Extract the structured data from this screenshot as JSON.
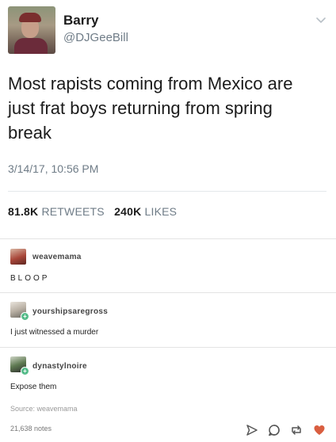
{
  "tweet": {
    "display_name": "Barry",
    "handle": "@DJGeeBill",
    "text_lines": [
      "Most rapists coming from Mexico are",
      "just frat boys returning from spring",
      "break"
    ],
    "timestamp": "3/14/17, 10:56 PM",
    "retweets_count": "81.8K",
    "retweets_label": "RETWEETS",
    "likes_count": "240K",
    "likes_label": "LIKES",
    "menu_icon": "chevron-down-icon"
  },
  "reblogs": [
    {
      "username": "weavemama",
      "text": "BLOOP"
    },
    {
      "username": "yourshipsaregross",
      "text": "I just witnessed a murder"
    },
    {
      "username": "dynastylnoire",
      "text": "Expose them"
    }
  ],
  "footer": {
    "source": "Source: weavemama",
    "notes": "21,638 notes",
    "actions": [
      "share-icon",
      "reply-icon",
      "reblog-icon",
      "like-icon"
    ]
  },
  "colors": {
    "twitter_gray": "#6f7c87",
    "badge_green": "#56bc8a",
    "like_red": "#d95e40"
  }
}
